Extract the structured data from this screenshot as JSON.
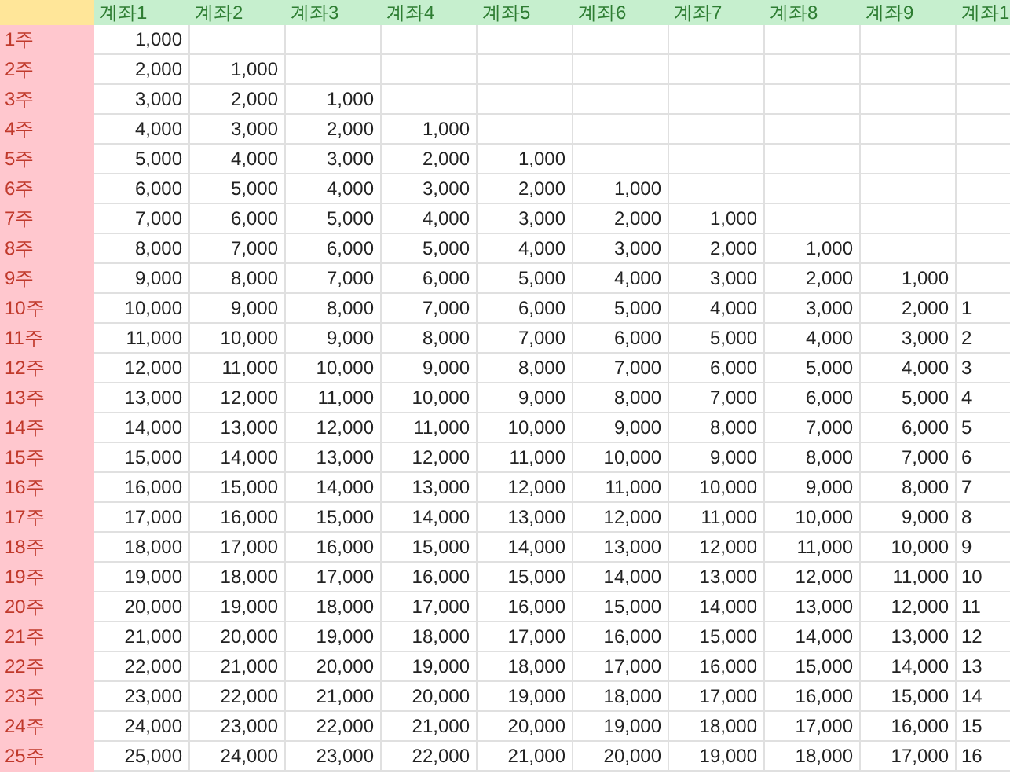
{
  "table": {
    "columns": [
      "계좌1",
      "계좌2",
      "계좌3",
      "계좌4",
      "계좌5",
      "계좌6",
      "계좌7",
      "계좌8",
      "계좌9",
      "계좌1"
    ],
    "rows": [
      {
        "label": "1주",
        "cells": [
          "1,000"
        ]
      },
      {
        "label": "2주",
        "cells": [
          "2,000",
          "1,000"
        ]
      },
      {
        "label": "3주",
        "cells": [
          "3,000",
          "2,000",
          "1,000"
        ]
      },
      {
        "label": "4주",
        "cells": [
          "4,000",
          "3,000",
          "2,000",
          "1,000"
        ]
      },
      {
        "label": "5주",
        "cells": [
          "5,000",
          "4,000",
          "3,000",
          "2,000",
          "1,000"
        ]
      },
      {
        "label": "6주",
        "cells": [
          "6,000",
          "5,000",
          "4,000",
          "3,000",
          "2,000",
          "1,000"
        ]
      },
      {
        "label": "7주",
        "cells": [
          "7,000",
          "6,000",
          "5,000",
          "4,000",
          "3,000",
          "2,000",
          "1,000"
        ]
      },
      {
        "label": "8주",
        "cells": [
          "8,000",
          "7,000",
          "6,000",
          "5,000",
          "4,000",
          "3,000",
          "2,000",
          "1,000"
        ]
      },
      {
        "label": "9주",
        "cells": [
          "9,000",
          "8,000",
          "7,000",
          "6,000",
          "5,000",
          "4,000",
          "3,000",
          "2,000",
          "1,000"
        ]
      },
      {
        "label": "10주",
        "cells": [
          "10,000",
          "9,000",
          "8,000",
          "7,000",
          "6,000",
          "5,000",
          "4,000",
          "3,000",
          "2,000",
          "1"
        ]
      },
      {
        "label": "11주",
        "cells": [
          "11,000",
          "10,000",
          "9,000",
          "8,000",
          "7,000",
          "6,000",
          "5,000",
          "4,000",
          "3,000",
          "2"
        ]
      },
      {
        "label": "12주",
        "cells": [
          "12,000",
          "11,000",
          "10,000",
          "9,000",
          "8,000",
          "7,000",
          "6,000",
          "5,000",
          "4,000",
          "3"
        ]
      },
      {
        "label": "13주",
        "cells": [
          "13,000",
          "12,000",
          "11,000",
          "10,000",
          "9,000",
          "8,000",
          "7,000",
          "6,000",
          "5,000",
          "4"
        ]
      },
      {
        "label": "14주",
        "cells": [
          "14,000",
          "13,000",
          "12,000",
          "11,000",
          "10,000",
          "9,000",
          "8,000",
          "7,000",
          "6,000",
          "5"
        ]
      },
      {
        "label": "15주",
        "cells": [
          "15,000",
          "14,000",
          "13,000",
          "12,000",
          "11,000",
          "10,000",
          "9,000",
          "8,000",
          "7,000",
          "6"
        ]
      },
      {
        "label": "16주",
        "cells": [
          "16,000",
          "15,000",
          "14,000",
          "13,000",
          "12,000",
          "11,000",
          "10,000",
          "9,000",
          "8,000",
          "7"
        ]
      },
      {
        "label": "17주",
        "cells": [
          "17,000",
          "16,000",
          "15,000",
          "14,000",
          "13,000",
          "12,000",
          "11,000",
          "10,000",
          "9,000",
          "8"
        ]
      },
      {
        "label": "18주",
        "cells": [
          "18,000",
          "17,000",
          "16,000",
          "15,000",
          "14,000",
          "13,000",
          "12,000",
          "11,000",
          "10,000",
          "9"
        ]
      },
      {
        "label": "19주",
        "cells": [
          "19,000",
          "18,000",
          "17,000",
          "16,000",
          "15,000",
          "14,000",
          "13,000",
          "12,000",
          "11,000",
          "10"
        ]
      },
      {
        "label": "20주",
        "cells": [
          "20,000",
          "19,000",
          "18,000",
          "17,000",
          "16,000",
          "15,000",
          "14,000",
          "13,000",
          "12,000",
          "11"
        ]
      },
      {
        "label": "21주",
        "cells": [
          "21,000",
          "20,000",
          "19,000",
          "18,000",
          "17,000",
          "16,000",
          "15,000",
          "14,000",
          "13,000",
          "12"
        ]
      },
      {
        "label": "22주",
        "cells": [
          "22,000",
          "21,000",
          "20,000",
          "19,000",
          "18,000",
          "17,000",
          "16,000",
          "15,000",
          "14,000",
          "13"
        ]
      },
      {
        "label": "23주",
        "cells": [
          "23,000",
          "22,000",
          "21,000",
          "20,000",
          "19,000",
          "18,000",
          "17,000",
          "16,000",
          "15,000",
          "14"
        ]
      },
      {
        "label": "24주",
        "cells": [
          "24,000",
          "23,000",
          "22,000",
          "21,000",
          "20,000",
          "19,000",
          "18,000",
          "17,000",
          "16,000",
          "15"
        ]
      },
      {
        "label": "25주",
        "cells": [
          "25,000",
          "24,000",
          "23,000",
          "22,000",
          "21,000",
          "20,000",
          "19,000",
          "18,000",
          "17,000",
          "16"
        ]
      }
    ]
  }
}
